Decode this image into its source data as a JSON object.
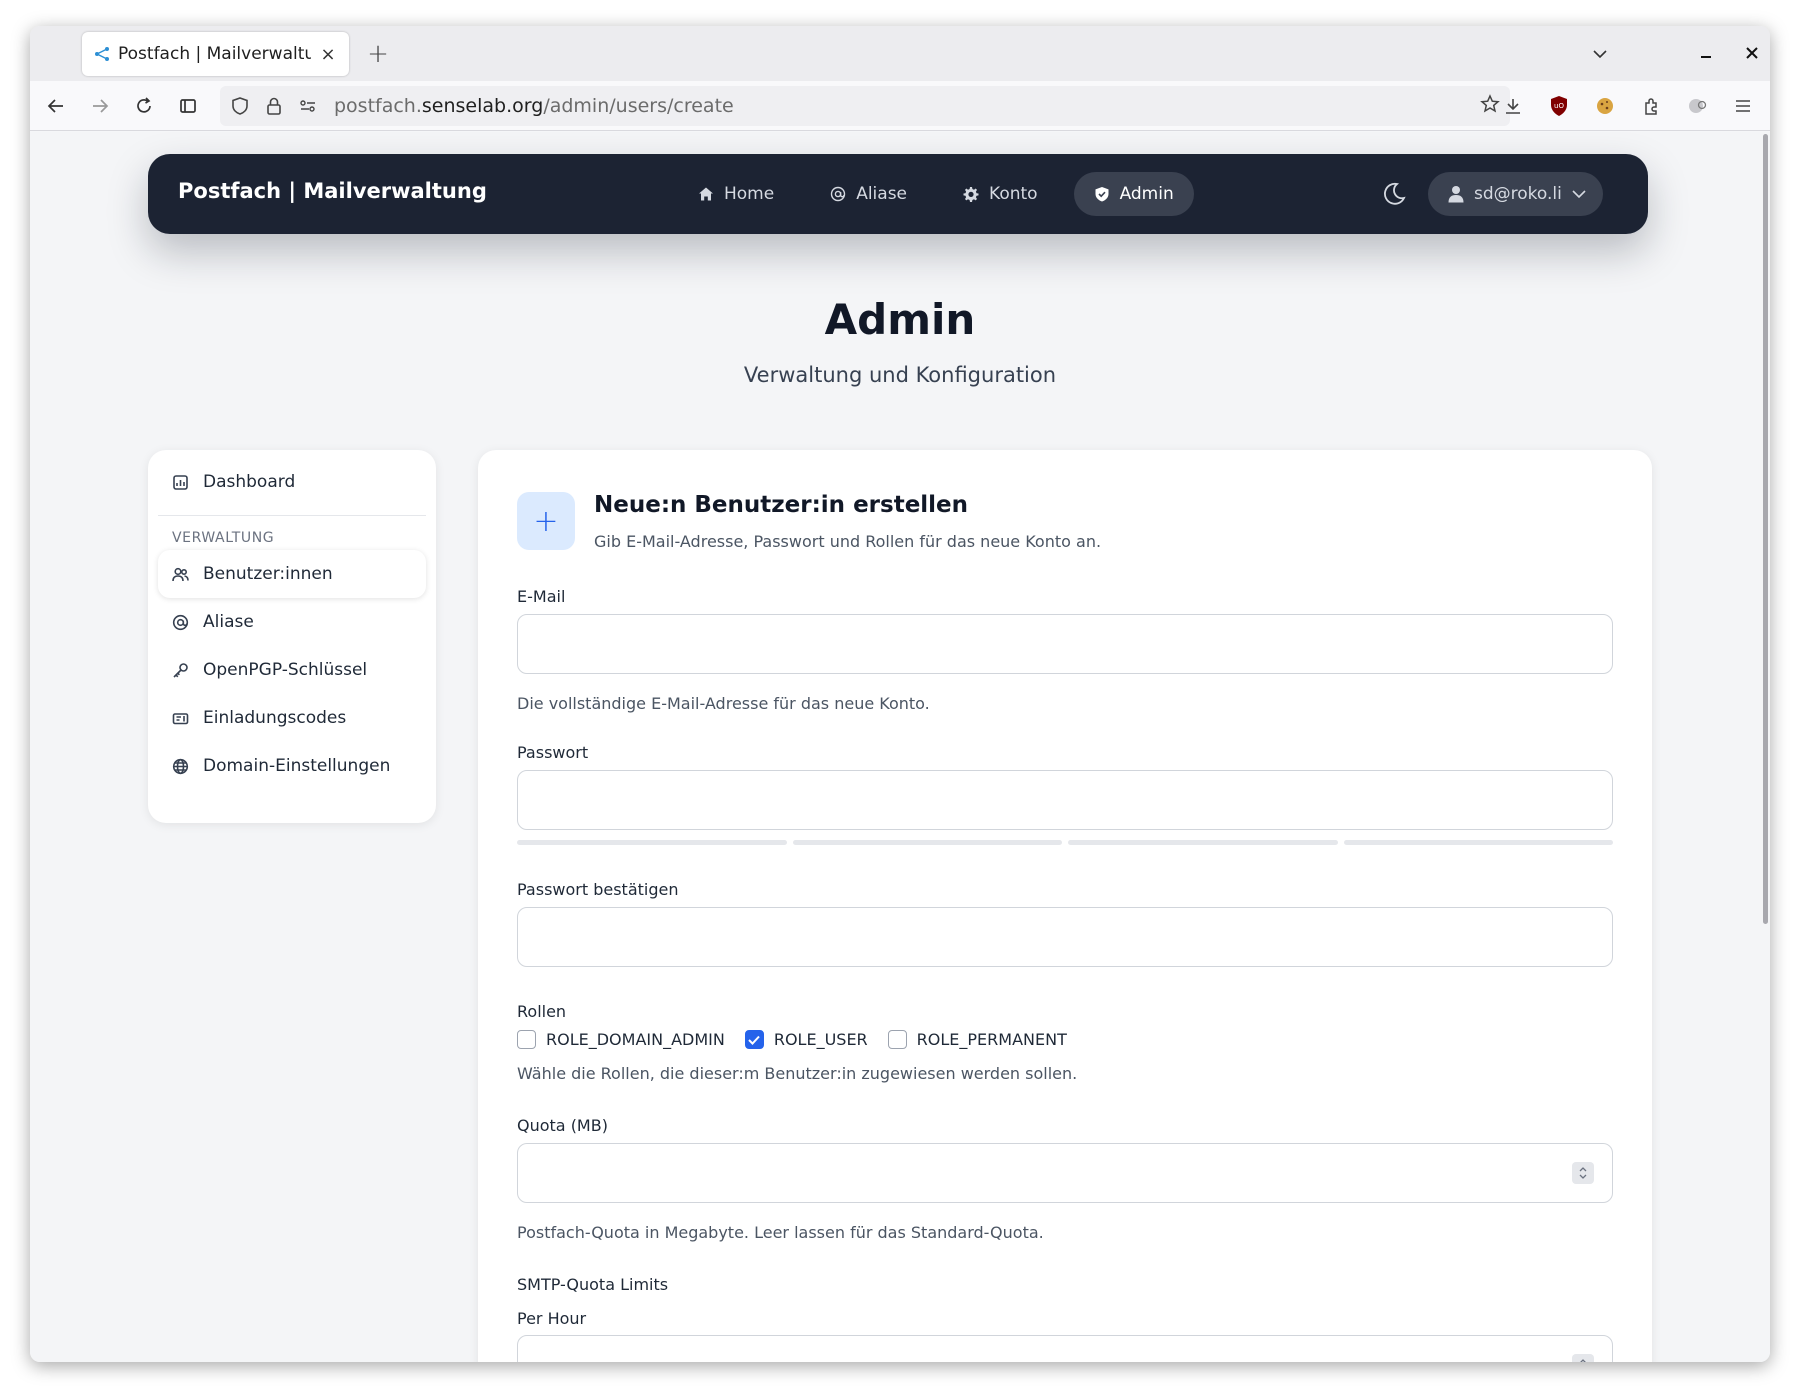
{
  "browser": {
    "tab_title": "Postfach | Mailverwaltung",
    "tab_close": "×",
    "new_tab": "+",
    "url_host_pre": "postfach.",
    "url_host": "senselab.org",
    "url_path": "/admin/users/create"
  },
  "navbar": {
    "brand": "Postfach | Mailverwaltung",
    "links": [
      {
        "label": "Home",
        "icon": "home-icon"
      },
      {
        "label": "Aliase",
        "icon": "at-icon"
      },
      {
        "label": "Konto",
        "icon": "gear-icon"
      },
      {
        "label": "Admin",
        "icon": "shield-icon",
        "active": true
      }
    ],
    "user": "sd@roko.li"
  },
  "header": {
    "title": "Admin",
    "subtitle": "Verwaltung und Konfiguration"
  },
  "sidebar": {
    "dashboard": "Dashboard",
    "section": "VERWALTUNG",
    "items": [
      {
        "label": "Benutzer:innen",
        "icon": "users-icon",
        "active": true
      },
      {
        "label": "Aliase",
        "icon": "at-icon"
      },
      {
        "label": "OpenPGP-Schlüssel",
        "icon": "key-icon"
      },
      {
        "label": "Einladungscodes",
        "icon": "ticket-icon"
      },
      {
        "label": "Domain-Einstellungen",
        "icon": "globe-icon"
      }
    ]
  },
  "form": {
    "icon": "+",
    "title": "Neue:n Benutzer:in erstellen",
    "description": "Gib E-Mail-Adresse, Passwort und Rollen für das neue Konto an.",
    "email_label": "E-Mail",
    "email_value": "",
    "email_help": "Die vollständige E-Mail-Adresse für das neue Konto.",
    "password_label": "Passwort",
    "password_value": "",
    "password_confirm_label": "Passwort bestätigen",
    "password_confirm_value": "",
    "roles_label": "Rollen",
    "roles": [
      {
        "label": "ROLE_DOMAIN_ADMIN",
        "checked": false
      },
      {
        "label": "ROLE_USER",
        "checked": true
      },
      {
        "label": "ROLE_PERMANENT",
        "checked": false
      }
    ],
    "roles_help": "Wähle die Rollen, die dieser:m Benutzer:in zugewiesen werden sollen.",
    "quota_label": "Quota (MB)",
    "quota_value": "",
    "quota_help": "Postfach-Quota in Megabyte. Leer lassen für das Standard-Quota.",
    "smtp_label": "SMTP-Quota Limits",
    "per_hour_label": "Per Hour"
  },
  "colors": {
    "navbar_bg": "#1c2333",
    "accent": "#2563eb",
    "icon_bg": "#dbeafe"
  }
}
